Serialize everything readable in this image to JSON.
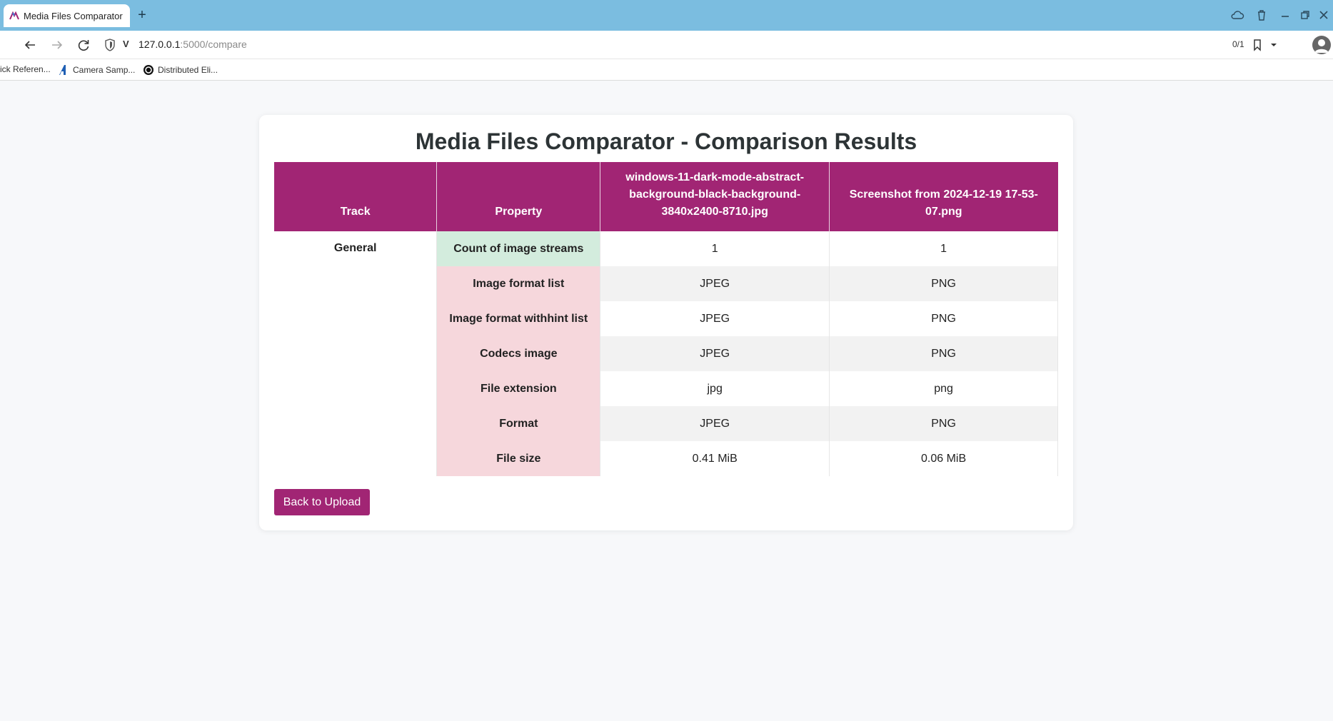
{
  "browser": {
    "tab_title": "Media Files Comparator - Comparison Results",
    "new_tab_symbol": "+",
    "url_host": "127.0.0.1",
    "url_path": ":5000/compare",
    "url_prefix": "V",
    "find_counter": "0/1",
    "bookmarks": [
      {
        "label": "ick Referen...",
        "icon": "bookmark-icon"
      },
      {
        "label": "Camera Samp...",
        "icon": "camera-app-icon"
      },
      {
        "label": "Distributed Eli...",
        "icon": "distributed-icon"
      }
    ],
    "colors": {
      "tabbar": "#7bbde0",
      "accent": "#a12574"
    }
  },
  "page": {
    "title": "Media Files Comparator - Comparison Results",
    "table": {
      "headers": {
        "track": "Track",
        "property": "Property",
        "file1": "windows-11-dark-mode-abstract-background-black-background-3840x2400-8710.jpg",
        "file2": "Screenshot from 2024-12-19 17-53-07.png"
      },
      "track_name": "General",
      "rows": [
        {
          "property": "Count of image streams",
          "file1": "1",
          "file2": "1",
          "match": true
        },
        {
          "property": "Image format list",
          "file1": "JPEG",
          "file2": "PNG",
          "match": false
        },
        {
          "property": "Image format withhint list",
          "file1": "JPEG",
          "file2": "PNG",
          "match": false
        },
        {
          "property": "Codecs image",
          "file1": "JPEG",
          "file2": "PNG",
          "match": false
        },
        {
          "property": "File extension",
          "file1": "jpg",
          "file2": "png",
          "match": false
        },
        {
          "property": "Format",
          "file1": "JPEG",
          "file2": "PNG",
          "match": false
        },
        {
          "property": "File size",
          "file1": "0.41 MiB",
          "file2": "0.06 MiB",
          "match": false
        }
      ]
    },
    "back_button": "Back to Upload",
    "colors": {
      "header_bg": "#a12574",
      "match_bg": "#d3ecdd",
      "diff_bg": "#f6d7dc"
    }
  }
}
